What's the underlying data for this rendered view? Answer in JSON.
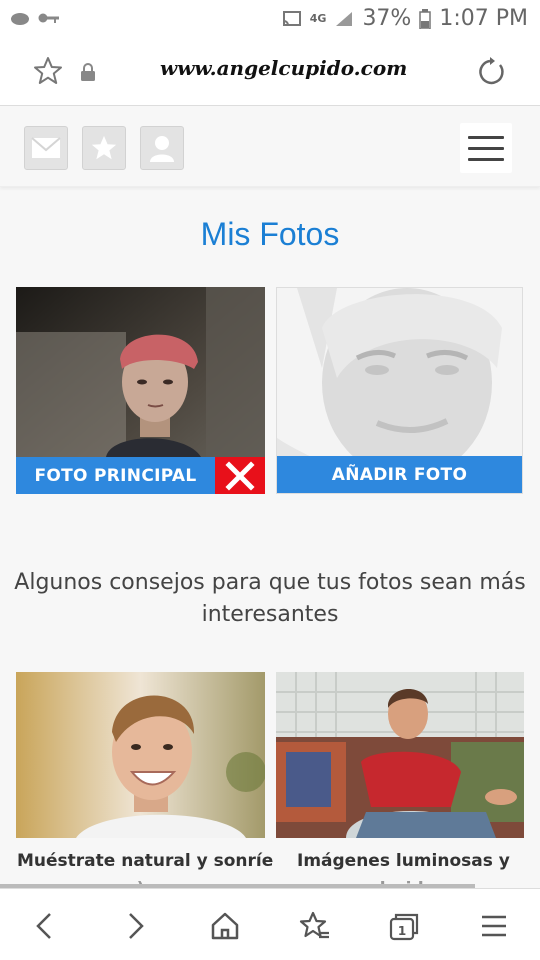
{
  "status_bar": {
    "network": "4G",
    "battery": "37%",
    "time": "1:07 PM"
  },
  "browser": {
    "url": "www.angelcupido.com"
  },
  "nav": {
    "icons": [
      "mail-icon",
      "star-icon",
      "profile-icon",
      "hamburger-menu-icon"
    ]
  },
  "page": {
    "title": "Mis Fotos",
    "main_photo_label": "FOTO PRINCIPAL",
    "add_photo_label": "AÑADIR FOTO",
    "tips_heading": "Algunos consejos para que tus fotos sean más interesantes",
    "tips": [
      {
        "caption": "Muéstrate natural y sonríe",
        "caption_line2": ":)"
      },
      {
        "caption": "Imágenes luminosas y",
        "caption_line2": "coloridas"
      }
    ]
  },
  "colors": {
    "accent": "#1b7fd4",
    "button_blue": "#2e88de",
    "delete_red": "#e8101a"
  },
  "bottom_bar": {
    "icons": [
      "back-icon",
      "forward-icon",
      "home-icon",
      "bookmarks-icon",
      "tabs-icon",
      "menu-icon"
    ],
    "tab_count": "1"
  }
}
